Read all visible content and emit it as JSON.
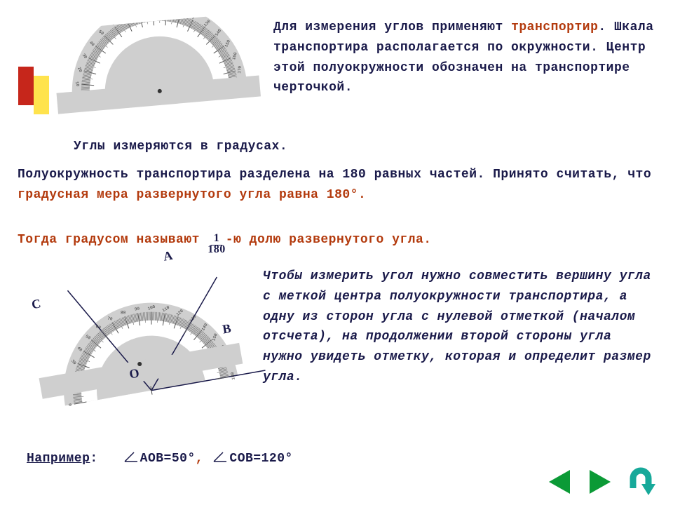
{
  "text": {
    "p1_a": "Для измерения углов применяют ",
    "p1_red": "транспортир",
    "p1_b": ". Шкала транспортира располагается по окружности. Центр этой полуокружности обозначен на транспортире черточкой.",
    "p2": "Углы измеряются в градусах.",
    "p3_a": "Полуокружность транспортира разделена на 180 равных частей. Принято считать, что ",
    "p3_red": "градусная мера развернутого угла равна 180°.",
    "p4_a": "Тогда градусом называют ",
    "p4_b": "-ю долю развернутого угла.",
    "frac_num": "1",
    "frac_den": "180",
    "p5": "Чтобы измерить угол нужно совместить вершину угла с меткой центра полуокружности транспортира, а одну из сторон угла с нулевой отметкой (началом отсчета), на продолжении второй стороны угла нужно увидеть отметку, которая и определит размер угла.",
    "example_label": "Например",
    "example_a": "АОВ=50°",
    "comma": ",",
    "example_b": "СОВ=120°"
  },
  "labels": {
    "A": "А",
    "B": "В",
    "C": "С",
    "O": "О"
  },
  "nav": {
    "prev": "◀",
    "next": "▶",
    "up": "⤴"
  },
  "colors": {
    "navGreen": "#0b9a36",
    "navTeal": "#17a99a",
    "text": "#1a1a4a",
    "accent": "#b33a0d"
  },
  "protractor": {
    "tick_numbers": [
      "0",
      "10",
      "20",
      "30",
      "40",
      "50",
      "60",
      "70",
      "80",
      "90",
      "100",
      "110",
      "120",
      "130",
      "140",
      "150",
      "160",
      "170",
      "180"
    ]
  }
}
